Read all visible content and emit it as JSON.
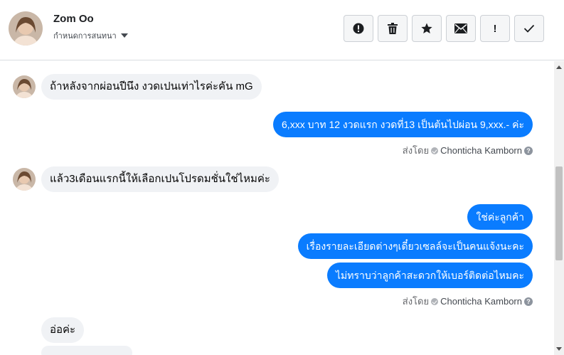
{
  "contact": {
    "name": "Zom Oo",
    "subtitle": "กำหนดการสนทนา"
  },
  "toolbar": [
    {
      "icon": "alert-icon",
      "label": ""
    },
    {
      "icon": "trash-icon",
      "label": ""
    },
    {
      "icon": "star-icon",
      "label": ""
    },
    {
      "icon": "mail-icon",
      "label": ""
    },
    {
      "icon": "exclamation-icon",
      "label": "!"
    },
    {
      "icon": "check-icon",
      "label": ""
    }
  ],
  "messages": {
    "m1": "ถ้าหลังจากผ่อนปีนึง งวดเปนเท่าไรค่ะคัน mG",
    "m2": "6,xxx บาท 12 งวดแรก    งวดที่13 เป็นต้นไปผ่อน  9,xxx.- ค่ะ",
    "m3": "แล้ว3เดือนแรกนี้ให้เลือกเปนโปรดมชั่นใช่ไหมค่ะ",
    "m4": "ใช่ค่ะลูกค้า",
    "m5": "เรื่องรายละเอียดต่างๆเดี๋ยวเซลล์จะเป็นคนแจ้งนะคะ",
    "m6": "ไม่ทราบว่าลูกค้าสะดวกให้เบอร์ติดต่อไหมคะ",
    "m7": "อ่อค่ะ"
  },
  "sent_by": {
    "label": "ส่งโดย",
    "name": "Chonticha Kamborn",
    "help": "?"
  },
  "colors": {
    "outgoing_bubble": "#0a7cff",
    "incoming_bubble": "#f0f2f5"
  }
}
